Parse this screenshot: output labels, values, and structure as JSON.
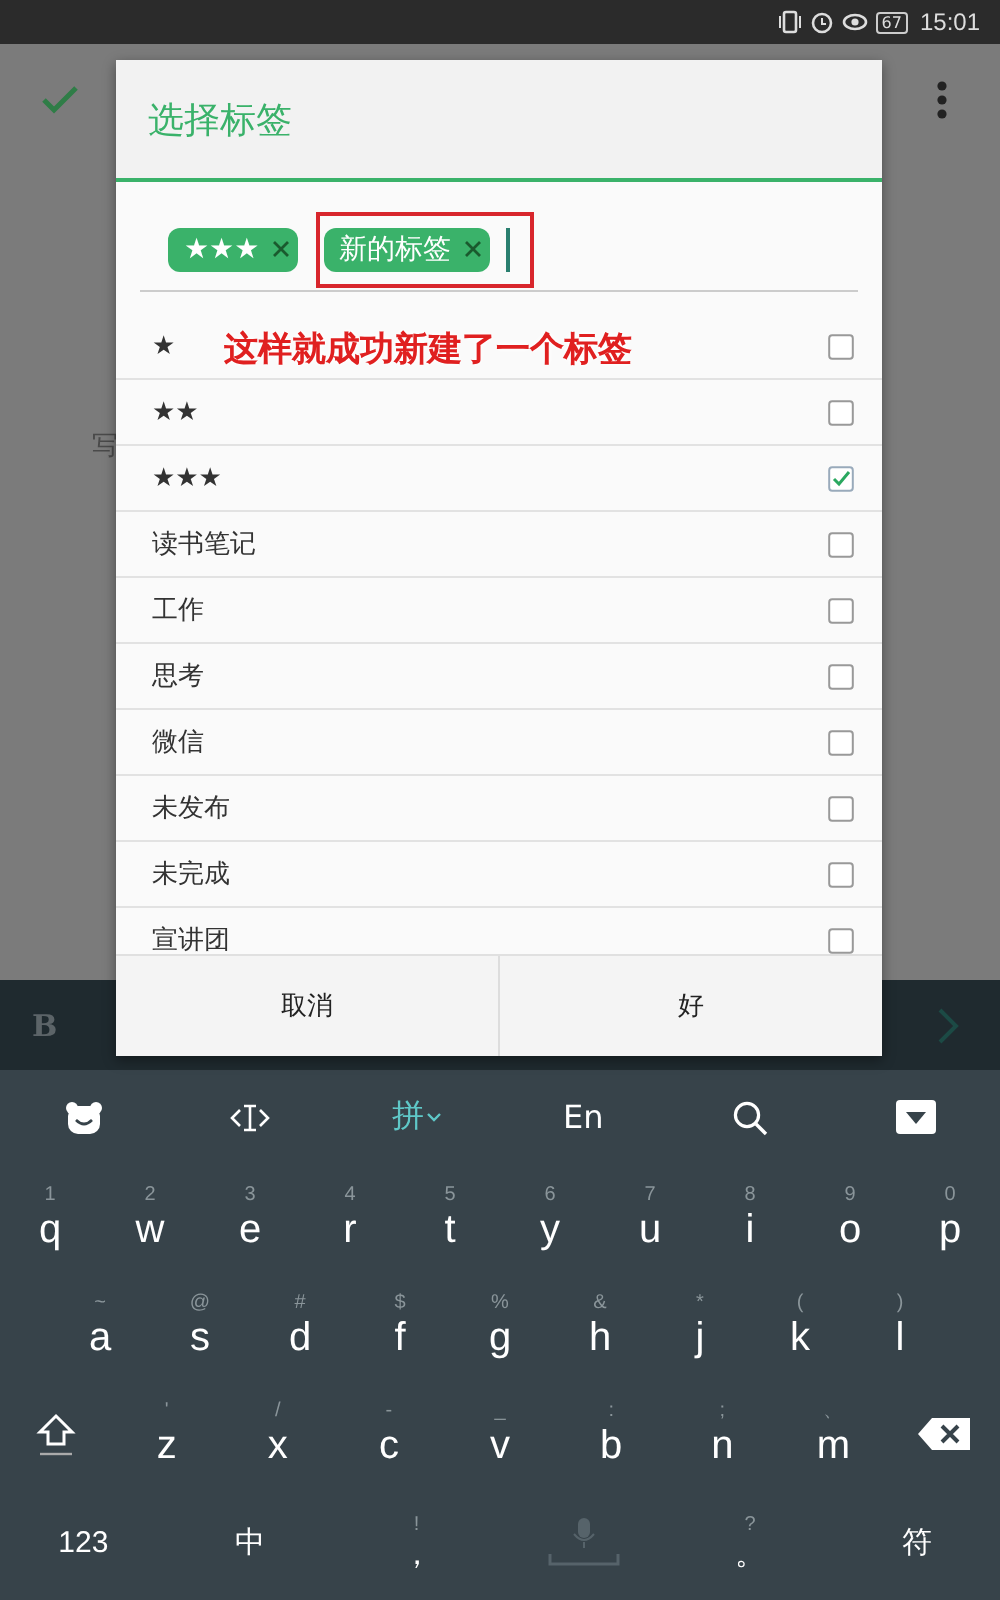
{
  "status_bar": {
    "battery": "67",
    "time": "15:01"
  },
  "background_app": {
    "body_text": "写",
    "toolbar_bold": "B"
  },
  "dialog": {
    "title": "选择标签",
    "chips": [
      {
        "label": "★★★",
        "highlighted": false
      },
      {
        "label": "新的标签",
        "highlighted": true
      }
    ],
    "annotation": "这样就成功新建了一个标签",
    "tags": [
      {
        "label": "★",
        "checked": false
      },
      {
        "label": "★★",
        "checked": false
      },
      {
        "label": "★★★",
        "checked": true
      },
      {
        "label": "读书笔记",
        "checked": false
      },
      {
        "label": "工作",
        "checked": false
      },
      {
        "label": "思考",
        "checked": false
      },
      {
        "label": "微信",
        "checked": false
      },
      {
        "label": "未发布",
        "checked": false
      },
      {
        "label": "未完成",
        "checked": false
      },
      {
        "label": "宣讲团",
        "checked": false
      }
    ],
    "buttons": [
      "取消",
      "好"
    ]
  },
  "keyboard": {
    "toolbar": [
      {
        "kind": "logo"
      },
      {
        "kind": "cursor"
      },
      {
        "kind": "text",
        "label": "拼",
        "selected": true
      },
      {
        "kind": "text",
        "label": "En",
        "selected": false
      },
      {
        "kind": "search"
      },
      {
        "kind": "hide"
      }
    ],
    "rows": [
      [
        {
          "label": "q",
          "hint": "1"
        },
        {
          "label": "w",
          "hint": "2"
        },
        {
          "label": "e",
          "hint": "3"
        },
        {
          "label": "r",
          "hint": "4"
        },
        {
          "label": "t",
          "hint": "5"
        },
        {
          "label": "y",
          "hint": "6"
        },
        {
          "label": "u",
          "hint": "7"
        },
        {
          "label": "i",
          "hint": "8"
        },
        {
          "label": "o",
          "hint": "9"
        },
        {
          "label": "p",
          "hint": "0"
        }
      ],
      [
        {
          "label": "a",
          "hint": "~"
        },
        {
          "label": "s",
          "hint": "@"
        },
        {
          "label": "d",
          "hint": "#"
        },
        {
          "label": "f",
          "hint": "$"
        },
        {
          "label": "g",
          "hint": "%"
        },
        {
          "label": "h",
          "hint": "&"
        },
        {
          "label": "j",
          "hint": "*"
        },
        {
          "label": "k",
          "hint": "("
        },
        {
          "label": "l",
          "hint": ")"
        }
      ],
      [
        {
          "kind": "shift"
        },
        {
          "label": "z",
          "hint": "'"
        },
        {
          "label": "x",
          "hint": "/"
        },
        {
          "label": "c",
          "hint": "-"
        },
        {
          "label": "v",
          "hint": "_"
        },
        {
          "label": "b",
          "hint": ":"
        },
        {
          "label": "n",
          "hint": ";"
        },
        {
          "label": "m",
          "hint": "、"
        },
        {
          "kind": "delete"
        }
      ],
      [
        {
          "label": "123"
        },
        {
          "label": "中"
        },
        {
          "label": "，",
          "hint": "!"
        },
        {
          "kind": "space"
        },
        {
          "label": "。",
          "hint": "?"
        },
        {
          "label": "符"
        }
      ]
    ]
  }
}
